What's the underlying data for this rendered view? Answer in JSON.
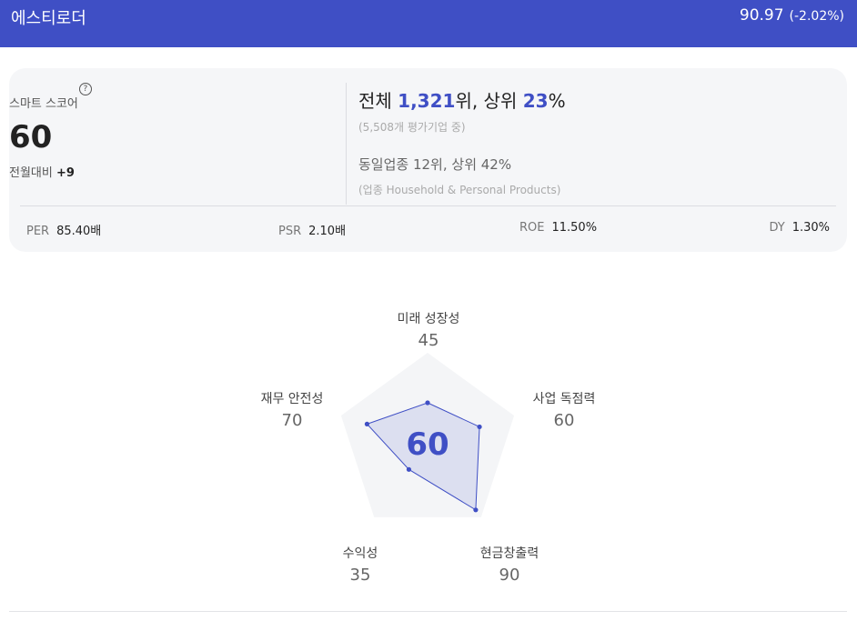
{
  "header": {
    "company_name": "에스티로더",
    "price": "90.97",
    "change": "(-2.02%)"
  },
  "score": {
    "label": "스마트 스코어",
    "help_icon": "question-circle-icon",
    "value": "60",
    "change_label": "전월대비",
    "change_value": "+9"
  },
  "rank": {
    "overall_prefix": "전체 ",
    "overall_rank": "1,321",
    "overall_mid": "위, 상위 ",
    "overall_percent": "23",
    "overall_suffix": "%",
    "overall_note": "(5,508개 평가기업 중)",
    "industry_text": "동일업종 12위, 상위 42%",
    "industry_note": "(업종 Household & Personal Products)"
  },
  "metrics": [
    {
      "label": "PER",
      "value": "85.40배"
    },
    {
      "label": "PSR",
      "value": "2.10배"
    },
    {
      "label": "ROE",
      "value": "11.50%"
    },
    {
      "label": "DY",
      "value": "1.30%"
    }
  ],
  "radar": {
    "center_score": "60",
    "max": 100,
    "accent_color": "#3f4fc5",
    "axes": [
      {
        "label": "미래 성장성",
        "value": 45
      },
      {
        "label": "사업 독점력",
        "value": 60
      },
      {
        "label": "현금창출력",
        "value": 90
      },
      {
        "label": "수익성",
        "value": 35
      },
      {
        "label": "재무 안전성",
        "value": 70
      }
    ]
  }
}
